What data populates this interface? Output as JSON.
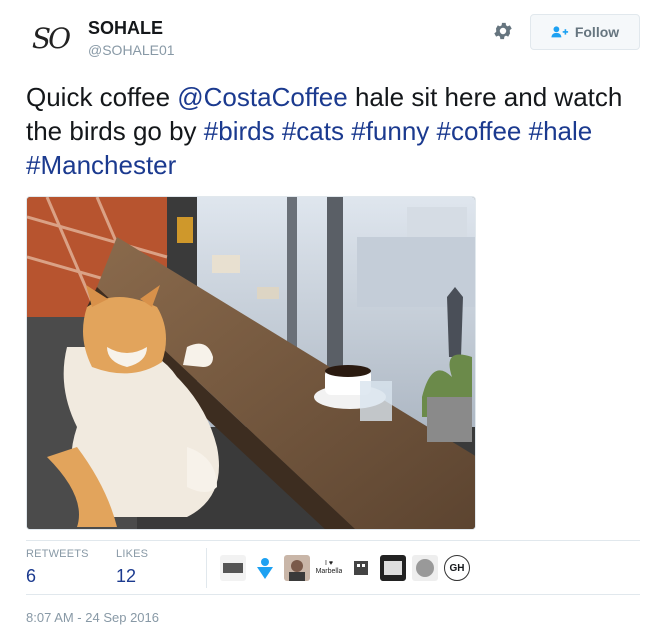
{
  "user": {
    "display_name": "SOHALE",
    "handle": "@SOHALE01",
    "avatar_text": "SO"
  },
  "actions": {
    "follow_label": "Follow"
  },
  "tweet": {
    "segments": [
      {
        "text": "Quick coffee ",
        "link": false
      },
      {
        "text": "@CostaCoffee",
        "link": true
      },
      {
        "text": " hale sit here and watch the birds go by ",
        "link": false
      },
      {
        "text": "#birds",
        "link": true
      },
      {
        "text": " ",
        "link": false
      },
      {
        "text": "#cats",
        "link": true
      },
      {
        "text": " ",
        "link": false
      },
      {
        "text": "#funny",
        "link": true
      },
      {
        "text": " ",
        "link": false
      },
      {
        "text": "#coffee",
        "link": true
      },
      {
        "text": " ",
        "link": false
      },
      {
        "text": "#hale",
        "link": true
      },
      {
        "text": " ",
        "link": false
      },
      {
        "text": "#Manchester",
        "link": true
      }
    ]
  },
  "stats": {
    "retweets_label": "RETWEETS",
    "retweets_value": "6",
    "likes_label": "LIKES",
    "likes_value": "12"
  },
  "likers": [
    {
      "name": "liker-1",
      "text": ""
    },
    {
      "name": "liker-2",
      "text": ""
    },
    {
      "name": "liker-3",
      "text": ""
    },
    {
      "name": "liker-4",
      "text": "I ♥ Marbella"
    },
    {
      "name": "liker-5",
      "text": ""
    },
    {
      "name": "liker-6",
      "text": ""
    },
    {
      "name": "liker-7",
      "text": ""
    },
    {
      "name": "liker-8",
      "text": "GH"
    }
  ],
  "timestamp": "8:07 AM - 24 Sep 2016",
  "colors": {
    "link": "#1b3a8f",
    "muted": "#8899a6",
    "border": "#e1e8ed"
  }
}
